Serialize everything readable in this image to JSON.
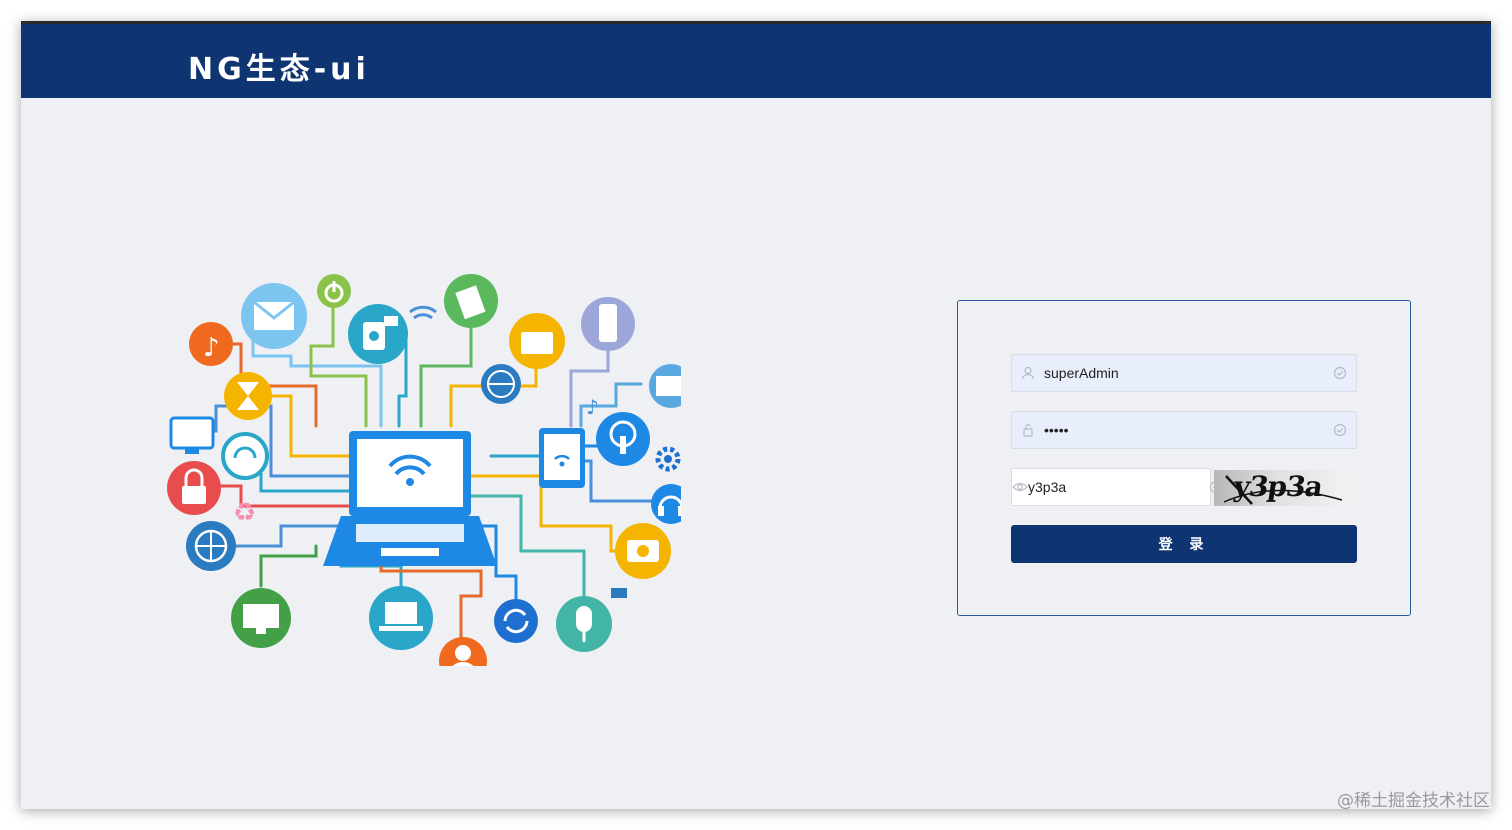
{
  "header": {
    "brand": "NG生态-ui"
  },
  "login": {
    "username": {
      "value": "superAdmin",
      "icon": "user-icon",
      "status_icon": "check-circle-icon"
    },
    "password": {
      "value": "•••••",
      "icon": "lock-icon",
      "status_icon": "check-circle-icon"
    },
    "captcha_input": {
      "value": "y3p3a",
      "icon": "eye-icon",
      "status_icon": "check-circle-icon"
    },
    "captcha_image_text": "y3p3a",
    "submit_label": "登 录"
  },
  "watermark": "@稀土掘金技术社区",
  "colors": {
    "brand": "#0e3572",
    "background": "#eef0f4",
    "input_fill": "#e8eefc"
  },
  "illustration": {
    "icons": [
      "music-icon",
      "mail-icon",
      "power-icon",
      "camera-icon",
      "wifi-icon",
      "note-icon",
      "folder-icon",
      "phone-icon",
      "globe-icon",
      "hourglass-icon",
      "monitor-icon",
      "headset-icon",
      "lock-icon",
      "recycle-icon",
      "laptop-icon",
      "tablet-icon",
      "podcast-icon",
      "gear-icon",
      "headphones-icon",
      "photo-icon",
      "sync-icon",
      "microphone-icon",
      "user-icon"
    ]
  }
}
